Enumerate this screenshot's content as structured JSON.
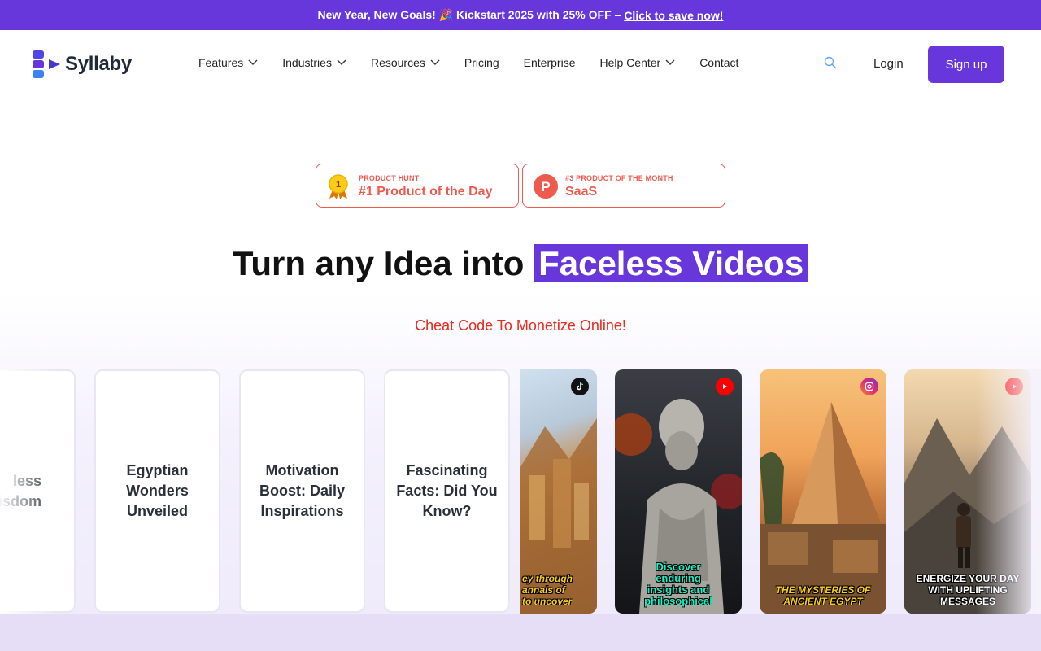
{
  "promo": {
    "text": "New Year, New Goals! 🎉 Kickstart 2025 with 25% OFF –",
    "link": "Click to save now!"
  },
  "nav": {
    "brand": "Syllaby",
    "items": [
      {
        "label": "Features",
        "dropdown": true
      },
      {
        "label": "Industries",
        "dropdown": true
      },
      {
        "label": "Resources",
        "dropdown": true
      },
      {
        "label": "Pricing",
        "dropdown": false
      },
      {
        "label": "Enterprise",
        "dropdown": false
      },
      {
        "label": "Help Center",
        "dropdown": true
      },
      {
        "label": "Contact",
        "dropdown": false
      }
    ],
    "login": "Login",
    "signup": "Sign up"
  },
  "badges": [
    {
      "small": "PRODUCT HUNT",
      "big": "#1 Product of the Day",
      "medal": "1"
    },
    {
      "small": "#3 PRODUCT OF THE MONTH",
      "big": "SaaS",
      "logo": "P"
    }
  ],
  "hero": {
    "headline_plain": "Turn any Idea into",
    "headline_highlight": "Faceless Videos",
    "tagline": "Cheat Code To Monetize Online!"
  },
  "cards": [
    {
      "title": "less\nisdom",
      "kind": "text"
    },
    {
      "title": "Egyptian Wonders Unveiled",
      "kind": "text"
    },
    {
      "title": "Motivation Boost: Daily Inspirations",
      "kind": "text"
    },
    {
      "title": "Fascinating Facts: Did You Know?",
      "kind": "text"
    },
    {
      "caption": "ey through\nannals of\nto uncover",
      "platform": "tiktok-icon"
    },
    {
      "caption": "Discover\nenduring\ninsights and\nphilosophical",
      "platform": "youtube-icon"
    },
    {
      "caption": "THE MYSTERIES OF\nANCIENT EGYPT",
      "platform": "instagram-icon"
    },
    {
      "caption": "ENERGIZE YOUR DAY\nWITH UPLIFTING\nMESSAGES",
      "platform": "youtube-icon"
    }
  ],
  "colors": {
    "brand": "#6737db",
    "accent_red": "#ef5a4f",
    "tagline_red": "#e52a1e"
  }
}
